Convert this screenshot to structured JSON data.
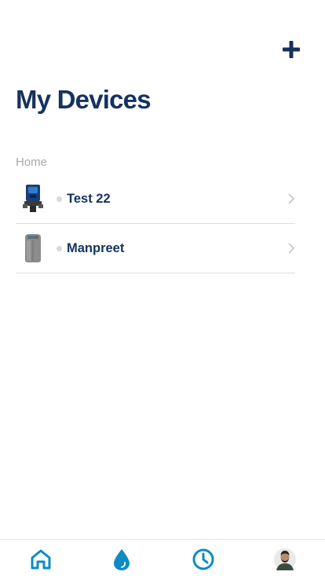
{
  "header": {
    "title": "My Devices",
    "add_icon": "plus-icon"
  },
  "section": {
    "label": "Home"
  },
  "devices": [
    {
      "name": "Test 22",
      "image": "valve-controller-device",
      "status": "offline",
      "chevron": "chevron-right-icon"
    },
    {
      "name": "Manpreet",
      "image": "water-softener-tank-device",
      "status": "offline",
      "chevron": "chevron-right-icon"
    }
  ],
  "tabbar": {
    "items": [
      {
        "icon": "home-icon",
        "active": true
      },
      {
        "icon": "water-drop-icon",
        "active": false
      },
      {
        "icon": "clock-icon",
        "active": false
      },
      {
        "icon": "profile-avatar",
        "active": false
      }
    ]
  },
  "colors": {
    "primary": "#15325f",
    "accent": "#0f8bc4",
    "muted": "#a8a8a8",
    "divider": "#dedede"
  }
}
